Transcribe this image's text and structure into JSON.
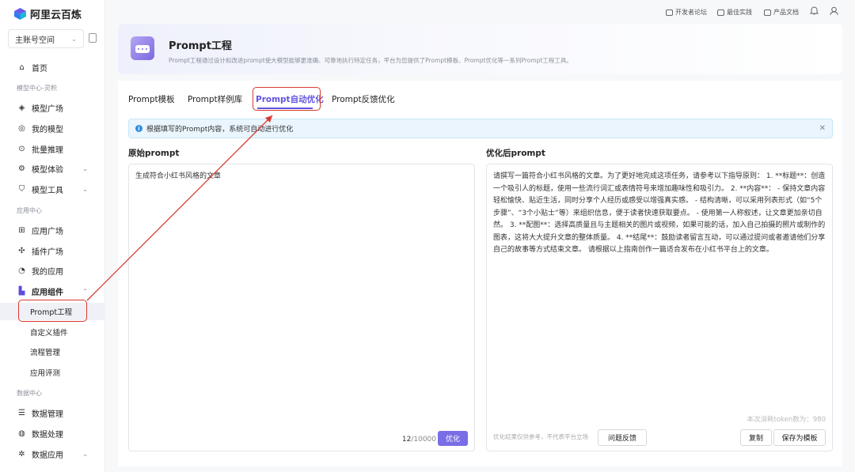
{
  "brand": {
    "name": "阿里云百炼"
  },
  "workspace": {
    "value": "主账号空间"
  },
  "sidebar": {
    "home": "首页",
    "section_model": "模型中心-灵积",
    "model_square": "模型广场",
    "my_models": "我的模型",
    "batch_infer": "批量推理",
    "model_experience": "模型体验",
    "model_tools": "模型工具",
    "section_app": "应用中心",
    "app_square": "应用广场",
    "plugin_square": "插件广场",
    "my_apps": "我的应用",
    "app_components": "应用组件",
    "sub_prompt": "Prompt工程",
    "sub_custom_plugin": "自定义插件",
    "sub_flow": "流程管理",
    "sub_app_eval": "应用评测",
    "section_data": "数据中心",
    "data_manage": "数据管理",
    "data_process": "数据处理",
    "data_apps": "数据应用"
  },
  "topbar": {
    "dev_forum": "开发者论坛",
    "best_practice": "最佳实践",
    "product_docs": "产品文档"
  },
  "header": {
    "title": "Prompt工程",
    "desc": "Prompt工程通过设计和改进prompt使大模型能够更准确、可靠地执行特定任务，平台为您提供了Prompt模板、Prompt优化等一系列Prompt工程工具。"
  },
  "tabs": [
    "Prompt模板",
    "Prompt样例库",
    "Prompt自动优化",
    "Prompt反馈优化"
  ],
  "alert": {
    "text": "根据填写的Prompt内容，系统可自动进行优化"
  },
  "left": {
    "title": "原始prompt",
    "content": "生成符合小红书风格的文章",
    "count": "12",
    "max": "/10000",
    "optimize_label": "优化"
  },
  "right": {
    "title": "优化后prompt",
    "content": "请撰写一篇符合小红书风格的文章。为了更好地完成这项任务，请参考以下指导原则： 1. **标题**：创造一个吸引人的标题，使用一些流行词汇或表情符号来增加趣味性和吸引力。 2. **内容**： - 保持文章内容轻松愉快、贴近生活，同时分享个人经历或感受以增强真实感。 - 结构清晰，可以采用列表形式（如“5个步骤”、“3个小贴士”等）来组织信息，便于读者快速获取要点。 - 使用第一人称叙述，让文章更加亲切自然。 3. **配图**：选择高质量且与主题相关的图片或视频，如果可能的话，加入自己拍摄的照片或制作的图表，这将大大提升文章的整体质量。 4. **结尾**：鼓励读者留言互动，可以通过提问或者邀请他们分享自己的故事等方式结束文章。 请根据以上指南创作一篇适合发布在小红书平台上的文章。",
    "tokens": "本次消耗token数为：980",
    "disclaimer": "优化结果仅供参考，不代表平台立场",
    "feedback_label": "问题反馈",
    "copy_label": "复制",
    "save_label": "保存为模板"
  },
  "colors": {
    "accent": "#6254e0",
    "annotation": "#d93a31"
  }
}
